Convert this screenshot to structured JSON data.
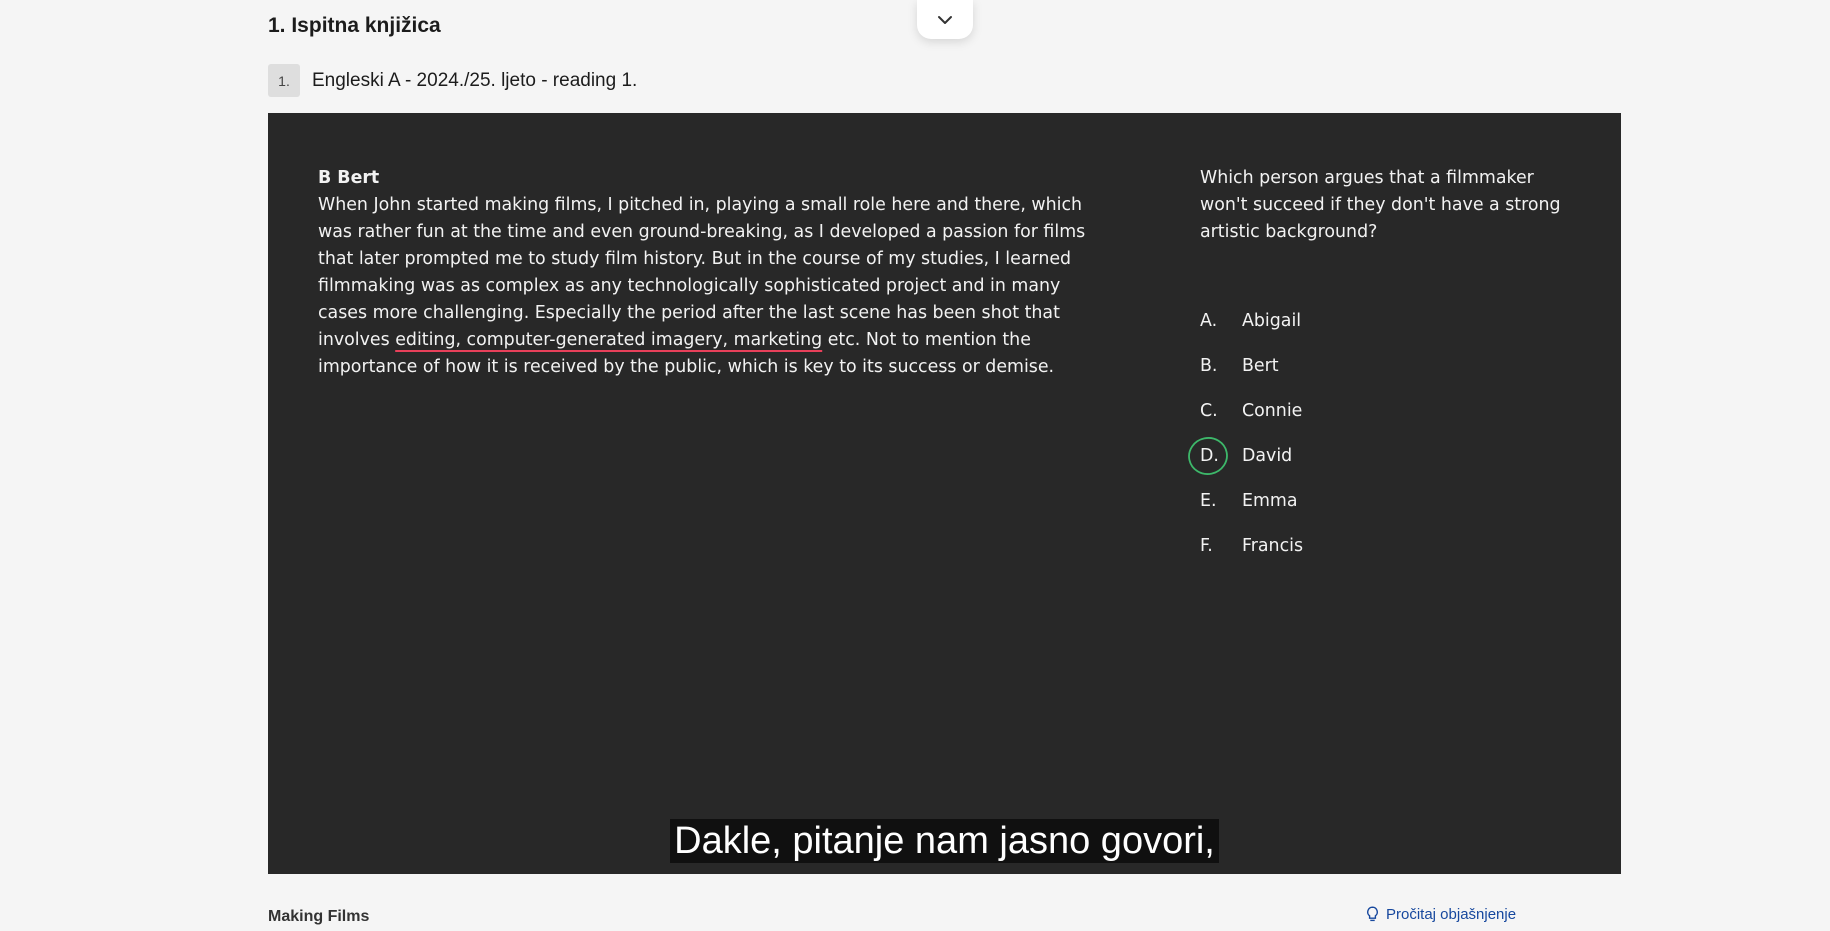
{
  "header": {
    "section_title": "1. Ispitna knjižica"
  },
  "item": {
    "number": "1.",
    "title": "Engleski A - 2024./25. ljeto - reading 1."
  },
  "passage": {
    "heading": "B Bert",
    "text_before": "When John started making films, I pitched in, playing a small role here and there, which was rather fun at the time and even ground-breaking, as I developed a passion for films that later prompted me to study film history. But in the course of my studies, I learned filmmaking was as complex as any technologically sophisticated project and in many cases more challenging. Especially the period after the last scene has been shot that involves ",
    "highlighted": "editing, computer-generated imagery, marketing",
    "text_after": " etc. Not to mention the importance of how it is received by the public, which is key to its success or demise."
  },
  "question": {
    "text": "Which person argues that a filmmaker won't succeed if they don't have a strong artistic background?",
    "options": [
      {
        "letter": "A.",
        "label": "Abigail"
      },
      {
        "letter": "B.",
        "label": "Bert"
      },
      {
        "letter": "C.",
        "label": "Connie"
      },
      {
        "letter": "D.",
        "label": "David"
      },
      {
        "letter": "E.",
        "label": "Emma"
      },
      {
        "letter": "F.",
        "label": "Francis"
      }
    ],
    "circled_option": "D.",
    "circle_color": "#3db86a",
    "highlight_color": "#e8405a"
  },
  "video": {
    "subtitle": "Dakle, pitanje nam jasno govori,"
  },
  "footer": {
    "title": "Making Films",
    "explain_link": "Pročitaj objašnjenje",
    "link_color": "#17489e"
  },
  "icons": {
    "collapse": "chevron-down-icon",
    "explain": "lightbulb-icon"
  }
}
